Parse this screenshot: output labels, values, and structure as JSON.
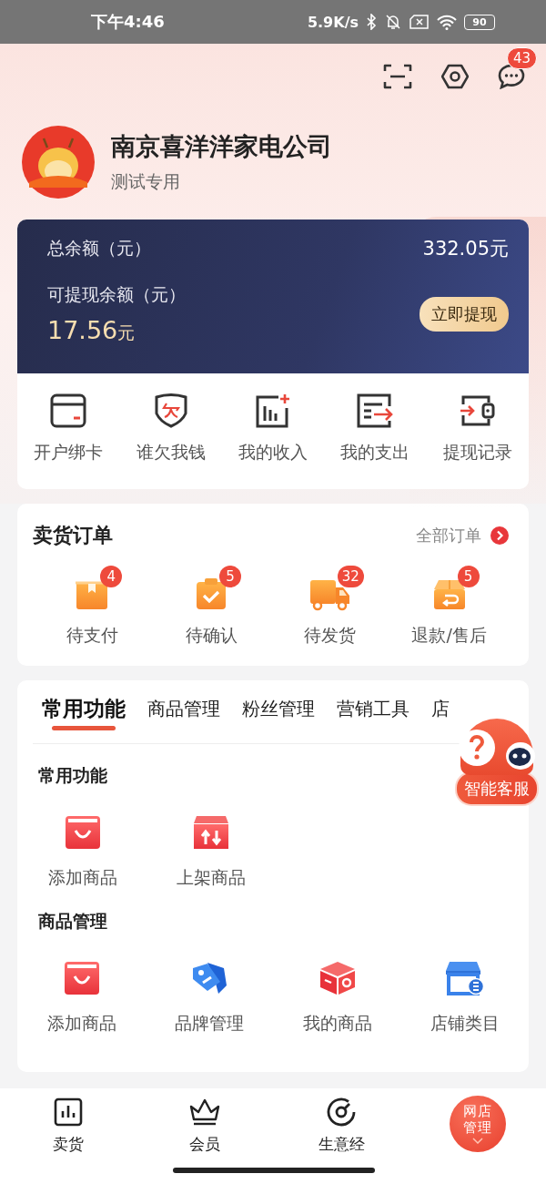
{
  "status_bar": {
    "time": "下午4:46",
    "net_speed": "5.9K/s",
    "battery": "90"
  },
  "header_actions": {
    "messages_badge": "43"
  },
  "profile": {
    "name": "南京喜洋洋家电公司",
    "subtitle": "测试专用"
  },
  "balance": {
    "total_label": "总余额（元）",
    "total_value": "332.05元",
    "withdrawable_label": "可提现余额（元）",
    "withdrawable_amount": "17.56",
    "withdrawable_unit": "元",
    "withdraw_button": "立即提现"
  },
  "wallet_actions": [
    {
      "label": "开户绑卡",
      "kind": "card"
    },
    {
      "label": "谁欠我钱",
      "kind": "debt"
    },
    {
      "label": "我的收入",
      "kind": "income"
    },
    {
      "label": "我的支出",
      "kind": "expense"
    },
    {
      "label": "提现记录",
      "kind": "withdraw"
    }
  ],
  "orders": {
    "title": "卖货订单",
    "all_link": "全部订单",
    "items": [
      {
        "label": "待支付",
        "badge": "4",
        "kind": "pay"
      },
      {
        "label": "待确认",
        "badge": "5",
        "kind": "confirm"
      },
      {
        "label": "待发货",
        "badge": "32",
        "kind": "ship"
      },
      {
        "label": "退款/售后",
        "badge": "5",
        "kind": "refund"
      }
    ]
  },
  "tabs": [
    {
      "label": "常用功能",
      "selected": true
    },
    {
      "label": "商品管理",
      "selected": false
    },
    {
      "label": "粉丝管理",
      "selected": false
    },
    {
      "label": "营销工具",
      "selected": false
    },
    {
      "label": "店",
      "selected": false
    }
  ],
  "sections": [
    {
      "title": "常用功能",
      "items": [
        {
          "label": "添加商品",
          "kind": "bag"
        },
        {
          "label": "上架商品",
          "kind": "shelf"
        }
      ]
    },
    {
      "title": "商品管理",
      "items": [
        {
          "label": "添加商品",
          "kind": "bag"
        },
        {
          "label": "品牌管理",
          "kind": "tag"
        },
        {
          "label": "我的商品",
          "kind": "box"
        },
        {
          "label": "店铺类目",
          "kind": "store"
        }
      ]
    }
  ],
  "assistant": {
    "label": "智能客服"
  },
  "bottom_nav": [
    {
      "label": "卖货",
      "kind": "chart"
    },
    {
      "label": "会员",
      "kind": "crown"
    },
    {
      "label": "生意经",
      "kind": "dial"
    },
    {
      "label": "网店管理",
      "kind": "shop"
    }
  ]
}
